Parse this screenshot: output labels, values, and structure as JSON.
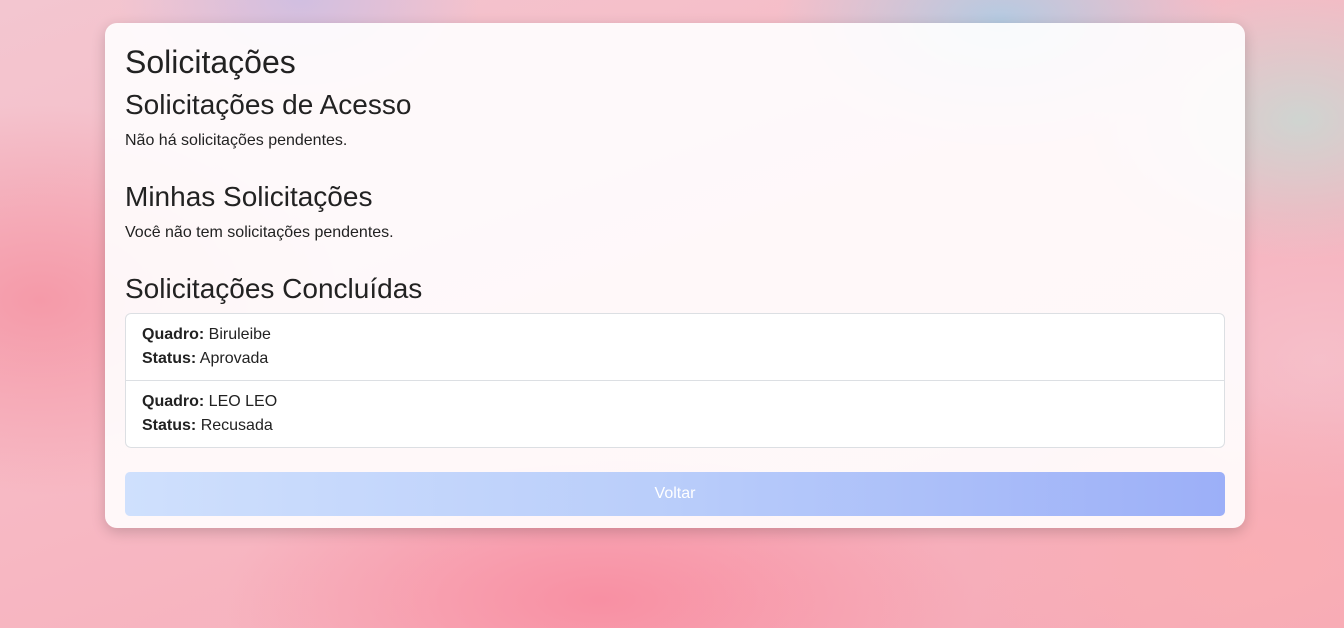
{
  "page": {
    "title": "Solicitações"
  },
  "access_requests": {
    "heading": "Solicitações de Acesso",
    "empty_text": "Não há solicitações pendentes."
  },
  "my_requests": {
    "heading": "Minhas Solicitações",
    "empty_text": "Você não tem solicitações pendentes."
  },
  "completed_requests": {
    "heading": "Solicitações Concluídas",
    "board_label": "Quadro:",
    "status_label": "Status:",
    "items": [
      {
        "board": "Biruleibe",
        "status": "Aprovada"
      },
      {
        "board": "LEO LEO",
        "status": "Recusada"
      }
    ]
  },
  "actions": {
    "back_label": "Voltar"
  }
}
